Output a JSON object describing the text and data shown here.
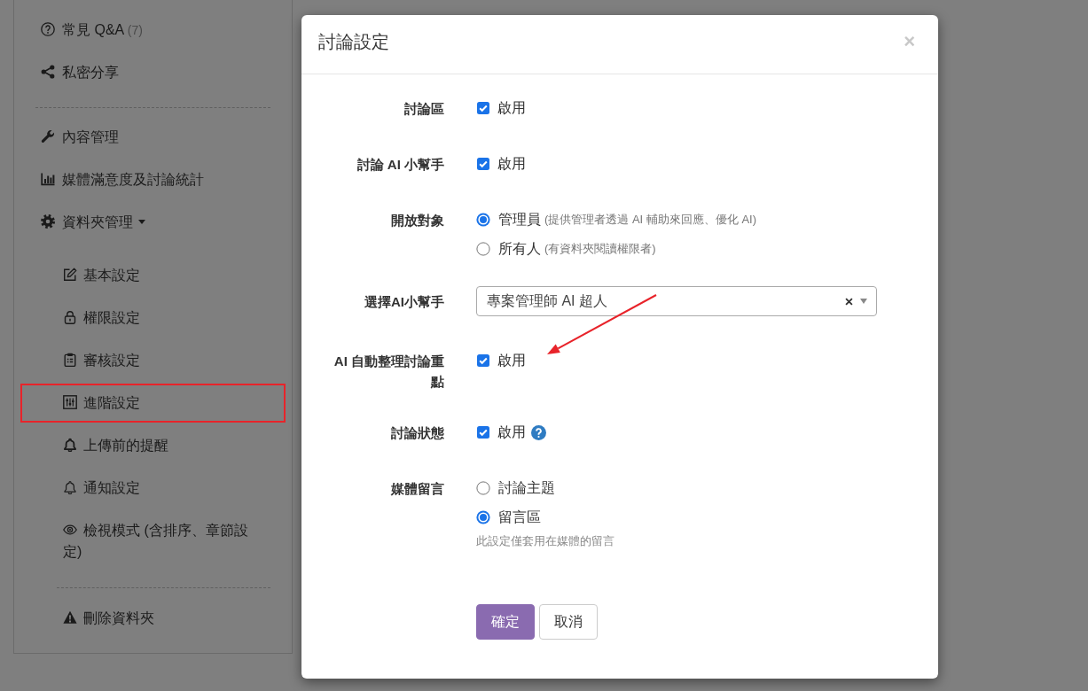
{
  "sidebar": {
    "items": [
      {
        "kind": "link",
        "label": "常見 Q&A",
        "count": "(7)",
        "highlighted": false
      },
      {
        "kind": "link",
        "label": "私密分享",
        "highlighted": false
      },
      {
        "kind": "divider"
      },
      {
        "kind": "link",
        "label": "內容管理",
        "highlighted": false
      },
      {
        "kind": "link",
        "label": "媒體滿意度及討論統計",
        "highlighted": false
      },
      {
        "kind": "link",
        "label": "資料夾管理",
        "highlighted": false,
        "expanded": true,
        "children": [
          {
            "kind": "link",
            "label": "基本設定",
            "highlighted": false
          },
          {
            "kind": "link",
            "label": "權限設定",
            "highlighted": false
          },
          {
            "kind": "link",
            "label": "審核設定",
            "highlighted": false
          },
          {
            "kind": "link",
            "label": "進階設定",
            "highlighted": true
          },
          {
            "kind": "link",
            "label": "上傳前的提醒",
            "highlighted": false
          },
          {
            "kind": "link",
            "label": "通知設定",
            "highlighted": false
          },
          {
            "kind": "link",
            "label": "檢視模式 (含排序、章節設定)",
            "highlighted": false
          },
          {
            "kind": "divider"
          },
          {
            "kind": "link",
            "label": "刪除資料夾",
            "highlighted": false
          }
        ]
      }
    ]
  },
  "dialog": {
    "title": "討論設定",
    "close": "×",
    "rows": [
      {
        "label": "討論區",
        "kind": "checkbox",
        "option": "啟用",
        "checked": true,
        "help": false,
        "arrow": false
      },
      {
        "label": "討論 AI 小幫手",
        "kind": "checkbox",
        "option": "啟用",
        "checked": true,
        "help": false,
        "arrow": false
      },
      {
        "label": "開放對象",
        "kind": "radio",
        "options": [
          {
            "label": "管理員",
            "hint": "(提供管理者透過 AI 輔助來回應、優化 AI)",
            "selected": true
          },
          {
            "label": "所有人",
            "hint": "(有資料夾閱讀權限者)",
            "selected": false
          }
        ],
        "help": false,
        "arrow": false
      },
      {
        "label": "選擇AI小幫手",
        "kind": "select",
        "value": "專案管理師 AI 超人",
        "help": false,
        "arrow": false
      },
      {
        "label": "AI 自動整理討論重點",
        "kind": "checkbox",
        "option": "啟用",
        "checked": true,
        "help": false,
        "arrow": true
      },
      {
        "label": "討論狀態",
        "kind": "checkbox",
        "option": "啟用",
        "checked": true,
        "help": true,
        "arrow": false
      },
      {
        "label": "媒體留言",
        "kind": "radio",
        "options": [
          {
            "label": "討論主題",
            "selected": false
          },
          {
            "label": "留言區",
            "selected": true
          }
        ],
        "note": "此設定僅套用在媒體的留言",
        "help": false,
        "arrow": false
      }
    ],
    "buttons": [
      {
        "label": "確定",
        "kind": "primary"
      },
      {
        "label": "取消",
        "kind": "default"
      }
    ]
  }
}
